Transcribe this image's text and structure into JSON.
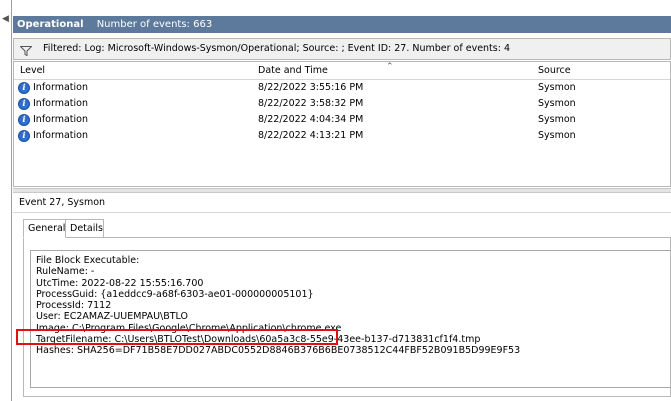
{
  "header": {
    "log_name": "Operational",
    "event_count_text": "Number of events: 663"
  },
  "filter": {
    "icon": "funnel-icon",
    "text": "Filtered: Log: Microsoft-Windows-Sysmon/Operational; Source: ; Event ID: 27. Number of events: 4"
  },
  "columns": {
    "level": "Level",
    "date_time": "Date and Time",
    "source": "Source"
  },
  "rows": [
    {
      "icon": "info-icon",
      "level": "Information",
      "date_time": "8/22/2022 3:55:16 PM",
      "source": "Sysmon"
    },
    {
      "icon": "info-icon",
      "level": "Information",
      "date_time": "8/22/2022 3:58:32 PM",
      "source": "Sysmon"
    },
    {
      "icon": "info-icon",
      "level": "Information",
      "date_time": "8/22/2022 4:04:34 PM",
      "source": "Sysmon"
    },
    {
      "icon": "info-icon",
      "level": "Information",
      "date_time": "8/22/2022 4:13:21 PM",
      "source": "Sysmon"
    }
  ],
  "detail": {
    "title": "Event 27, Sysmon",
    "tabs": [
      "General",
      "Details"
    ],
    "active_tab": "General",
    "lines": [
      "File Block Executable:",
      "RuleName: -",
      "UtcTime: 2022-08-22 15:55:16.700",
      "ProcessGuid: {a1eddcc9-a68f-6303-ae01-000000005101}",
      "ProcessId: 7112",
      "User: EC2AMAZ-UUEMPAU\\BTLO",
      "Image: C:\\Program Files\\Google\\Chrome\\Application\\chrome.exe",
      "TargetFilename: C:\\Users\\BTLOTest\\Downloads\\60a5a3c8-55e9-43ee-b137-d713831cf1f4.tmp",
      "Hashes: SHA256=DF71B58E7DD027ABDC0552D8846B376B6BE0738512C44FBF52B091B5D99E9F53"
    ],
    "highlight_color": "#e01010"
  },
  "colors": {
    "title_bar": "#5d7a9c",
    "info_blue": "#2e6fcf"
  }
}
